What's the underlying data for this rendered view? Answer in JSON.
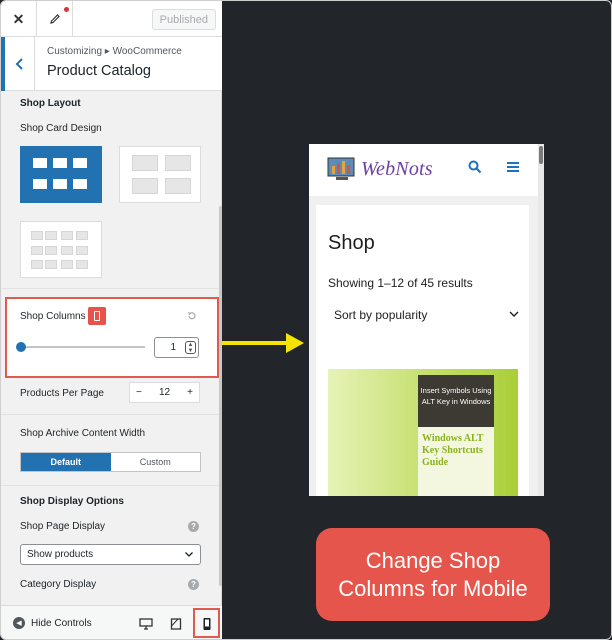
{
  "topbar": {
    "close_icon": "✕",
    "published_label": "Published"
  },
  "header": {
    "breadcrumb": "Customizing ▸ WooCommerce",
    "title": "Product Catalog"
  },
  "panel": {
    "shop_layout_heading": "Shop Layout",
    "card_design_label": "Shop Card Design",
    "shop_columns_label": "Shop Columns",
    "shop_columns_value": "1",
    "products_per_page_label": "Products Per Page",
    "products_per_page_value": "12",
    "stepper_minus": "−",
    "stepper_plus": "+",
    "archive_width_label": "Shop Archive Content Width",
    "width_options": [
      "Default",
      "Custom"
    ],
    "display_options_heading": "Shop Display Options",
    "shop_page_display_label": "Shop Page Display",
    "shop_page_display_value": "Show products",
    "category_display_label": "Category Display",
    "help_glyph": "?"
  },
  "footer": {
    "hide_controls_label": "Hide Controls"
  },
  "preview": {
    "logo_text": "WebNots",
    "shop_title": "Shop",
    "results_text": "Showing 1–12 of 45 results",
    "sort_value": "Sort by popularity",
    "product_dark_text": "Insert Symbols Using ALT Key in Windows",
    "product_light_text": "Windows ALT Key Shortcuts Guide"
  },
  "callout": {
    "line1": "Change Shop",
    "line2": "Columns for Mobile"
  },
  "colors": {
    "accent": "#2271b1",
    "highlight": "#e5554b",
    "arrow": "#f5e400"
  }
}
